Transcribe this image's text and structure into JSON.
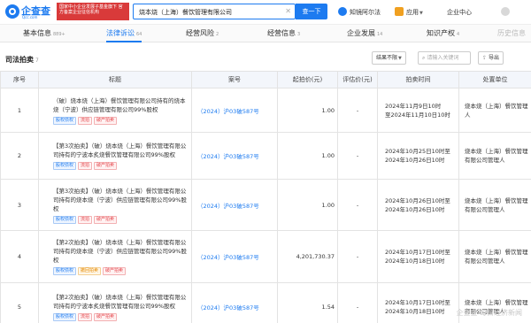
{
  "brand": {
    "name": "企查查",
    "sub": "Qcc.com",
    "notice": "国家中小企业发展子基金旗下 官方备案企业征信机构"
  },
  "search": {
    "value": "烧本烧（上海）餐饮管理有限公司",
    "button": "查一下"
  },
  "header_links": {
    "brand_link": "知镜阿尔法",
    "app": "应用",
    "enterprise": "企业中心"
  },
  "tabs": [
    {
      "label": "基本信息",
      "count": "889+"
    },
    {
      "label": "法律诉讼",
      "count": "64"
    },
    {
      "label": "经营风险",
      "count": "2"
    },
    {
      "label": "经营信息",
      "count": "3"
    },
    {
      "label": "企业发展",
      "count": "14"
    },
    {
      "label": "知识产权",
      "count": "4"
    },
    {
      "label": "历史信息",
      "count": ""
    }
  ],
  "section": {
    "title": "司法拍卖",
    "count": "7",
    "filter": "结果不限",
    "search_placeholder": "请输入关键词",
    "export": "导出"
  },
  "table": {
    "headers": [
      "序号",
      "标题",
      "案号",
      "起拍价(元)",
      "评估价(元)",
      "拍卖时间",
      "处置单位"
    ],
    "rows": [
      {
        "idx": "1",
        "title": "（破）烧本烧（上海）餐饮管理有限公司持有的烧本烧（宁波）供应链管理有限公司99%股权",
        "tags": [
          {
            "text": "股权债权",
            "color": "blue"
          },
          {
            "text": "流拍",
            "color": "red"
          },
          {
            "text": "破产拍卖",
            "color": "red"
          }
        ],
        "case": "（2024）沪03破587号",
        "start_price": "1.00",
        "eval_price": "-",
        "date1": "2024年11月9日10时",
        "date2": "至2024年11月10日10时",
        "unit": "烧本烧（上海）餐饮管理人"
      },
      {
        "idx": "2",
        "title": "【第3次拍卖】（破）烧本烧（上海）餐饮管理有限公司持有的宁波本炙烧餐饮管理有限公司99%股权",
        "tags": [
          {
            "text": "股权债权",
            "color": "blue"
          },
          {
            "text": "流拍",
            "color": "red"
          },
          {
            "text": "破产拍卖",
            "color": "red"
          }
        ],
        "case": "（2024）沪03破587号",
        "start_price": "1.00",
        "eval_price": "-",
        "date1": "2024年10月25日10时至",
        "date2": "2024年10月26日10时",
        "unit": "烧本烧（上海）餐饮管理有限公司管理人"
      },
      {
        "idx": "3",
        "title": "【第3次拍卖】（破）烧本烧（上海）餐饮管理有限公司持有的烧本烧（宁波）供应链管理有限公司99%股权",
        "tags": [
          {
            "text": "股权债权",
            "color": "blue"
          },
          {
            "text": "流拍",
            "color": "red"
          },
          {
            "text": "破产拍卖",
            "color": "red"
          }
        ],
        "case": "（2024）沪03破587号",
        "start_price": "1.00",
        "eval_price": "-",
        "date1": "2024年10月26日10时至",
        "date2": "2024年10月26日10时",
        "unit": "烧本烧（上海）餐饮管理有限公司管理人"
      },
      {
        "idx": "4",
        "title": "【第2次拍卖】（破）烧本烧（上海）餐饮管理有限公司持有的烧本烧（宁波）供应链管理有限公司99%股权",
        "tags": [
          {
            "text": "股权债权",
            "color": "blue"
          },
          {
            "text": "撤回拍卖",
            "color": "orange"
          },
          {
            "text": "破产拍卖",
            "color": "red"
          }
        ],
        "case": "（2024）沪03破587号",
        "start_price": "4,201,730.37",
        "eval_price": "-",
        "date1": "2024年10月17日10时至",
        "date2": "2024年10月18日10时",
        "unit": "烧本烧（上海）餐饮管理有限公司管理人"
      },
      {
        "idx": "5",
        "title": "【第2次拍卖】（破）烧本烧（上海）餐饮管理有限公司持有的宁波本炙烧餐饮管理有限公司99%股权",
        "tags": [
          {
            "text": "股权债权",
            "color": "blue"
          },
          {
            "text": "流拍",
            "color": "red"
          },
          {
            "text": "破产拍卖",
            "color": "red"
          }
        ],
        "case": "（2024）沪03破587号",
        "start_price": "1.54",
        "eval_price": "-",
        "date1": "2024年10月17日10时至",
        "date2": "2024年10月18日10时",
        "unit": "烧本烧（上海）餐饮管理有限公司管理人"
      }
    ]
  },
  "watermark": "企查查 每日经济新闻",
  "colors": {
    "accent": "#1d7bf0",
    "notice_bg": "#d93a3a"
  }
}
